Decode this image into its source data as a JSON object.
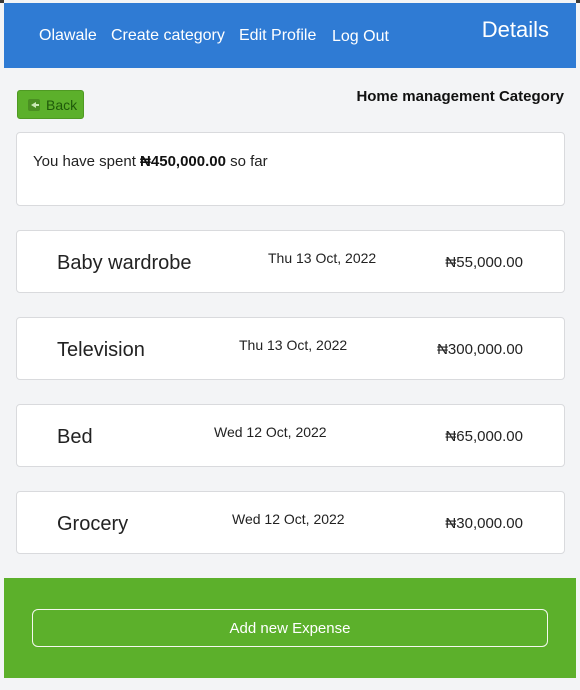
{
  "navbar": {
    "links": [
      "Olawale",
      "Create category",
      "Edit Profile",
      "Log Out"
    ],
    "title": "Details"
  },
  "back_button": {
    "label": "Back",
    "icon": "back-arrow-icon"
  },
  "category_heading": "Home management Category",
  "summary": {
    "prefix": "You have spent ",
    "amount": "₦450,000.00",
    "suffix": " so far"
  },
  "expenses": [
    {
      "name": "Baby wardrobe",
      "date": "Thu 13 Oct, 2022",
      "amount": "₦55,000.00"
    },
    {
      "name": "Television",
      "date": "Thu 13 Oct, 2022",
      "amount": "₦300,000.00"
    },
    {
      "name": "Bed",
      "date": "Wed 12 Oct, 2022",
      "amount": "₦65,000.00"
    },
    {
      "name": "Grocery",
      "date": "Wed 12 Oct, 2022",
      "amount": "₦30,000.00"
    }
  ],
  "footer": {
    "add_button_label": "Add new Expense"
  },
  "colors": {
    "navbar": "#2f7bd4",
    "accent_green": "#5cb02b",
    "background": "#f3f4f6"
  }
}
